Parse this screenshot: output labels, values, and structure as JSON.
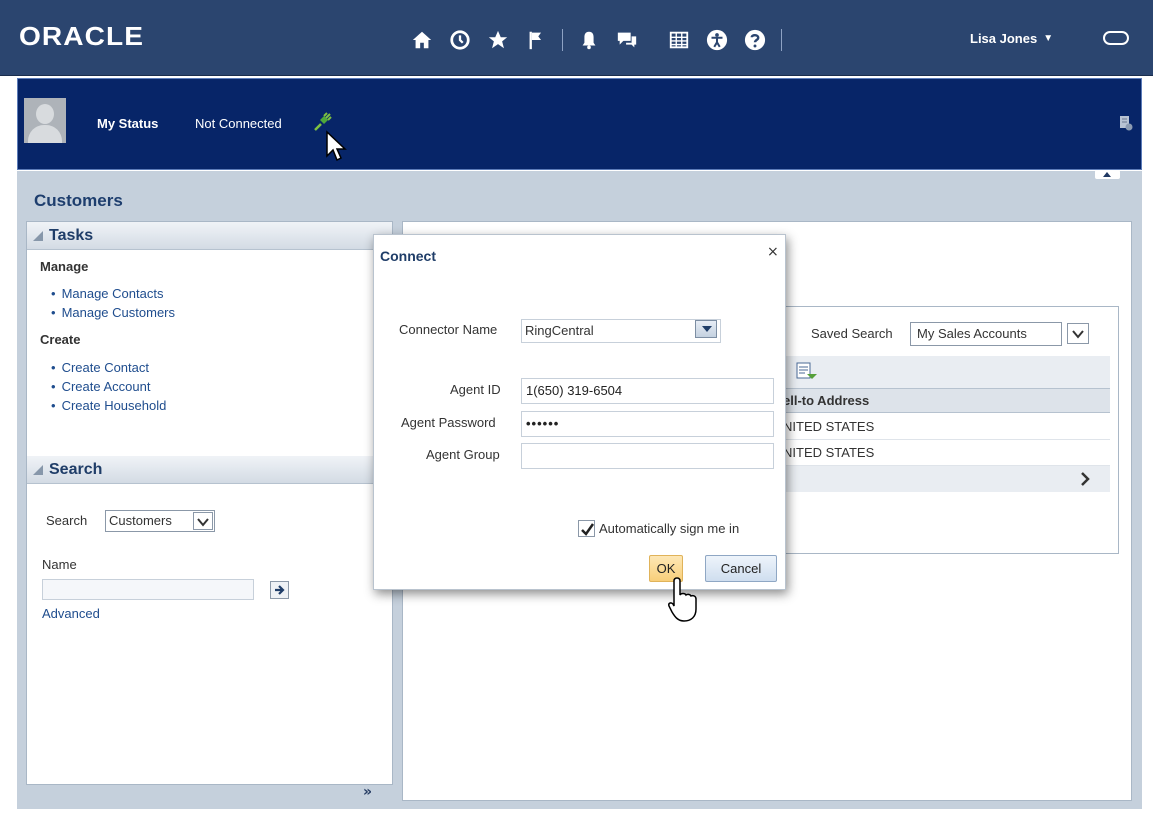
{
  "brand": {
    "logo_text": "ORACLE"
  },
  "header": {
    "icons": [
      "home-icon",
      "recent-icon",
      "favorites-icon",
      "flag-icon",
      "notifications-icon",
      "chat-icon",
      "grid-icon",
      "accessibility-icon",
      "help-icon"
    ],
    "user_name": "Lisa Jones",
    "colors": {
      "bar": "#2b456f",
      "status_strip": "#072568"
    }
  },
  "status": {
    "label": "My Status",
    "value": "Not Connected"
  },
  "page": {
    "title": "Customers"
  },
  "tasks": {
    "title": "Tasks",
    "manage_heading": "Manage",
    "manage_items": [
      "Manage Contacts",
      "Manage Customers"
    ],
    "create_heading": "Create",
    "create_items": [
      "Create Contact",
      "Create Account",
      "Create Household"
    ]
  },
  "search": {
    "title": "Search",
    "search_label": "Search",
    "search_value": "Customers",
    "name_label": "Name",
    "name_value": "",
    "advanced_link": "Advanced"
  },
  "results": {
    "saved_search_label": "Saved Search",
    "saved_search_value": "My Sales Accounts",
    "column_header": "ell-to Address",
    "rows": [
      "NITED STATES",
      "NITED STATES"
    ]
  },
  "dialog": {
    "title": "Connect",
    "close_glyph": "×",
    "connector_label": "Connector Name",
    "connector_value": "RingCentral",
    "agent_id_label": "Agent ID",
    "agent_id_value": "1(650) 319-6504",
    "agent_password_label": "Agent Password",
    "agent_password_value": "••••••",
    "agent_group_label": "Agent Group",
    "agent_group_value": "",
    "auto_sign_in_label": "Automatically sign me in",
    "auto_sign_in_checked": true,
    "ok_label": "OK",
    "cancel_label": "Cancel"
  }
}
